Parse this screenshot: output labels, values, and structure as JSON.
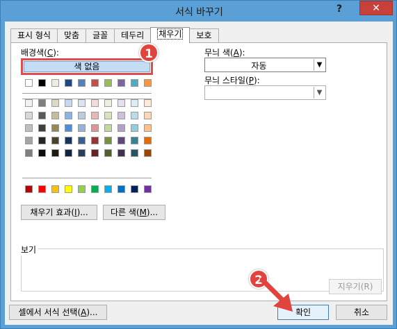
{
  "window": {
    "title": "서식 바꾸기",
    "help": "?",
    "close": "✕"
  },
  "tabs": [
    {
      "label": "표시 형식"
    },
    {
      "label": "맞춤"
    },
    {
      "label": "글꼴"
    },
    {
      "label": "테두리"
    },
    {
      "label": "채우기",
      "active": true
    },
    {
      "label": "보호"
    }
  ],
  "fill": {
    "bg_label_prefix": "배경색(",
    "bg_label_key": "C",
    "bg_label_suffix": "):",
    "no_color": "색 없음",
    "theme_row": [
      "#ffffff",
      "#000000",
      "#eeece1",
      "#1f497d",
      "#4f81bd",
      "#c0504d",
      "#9bbb59",
      "#8064a2",
      "#4bacc6",
      "#f79646"
    ],
    "shade_rows": [
      [
        "#f2f2f2",
        "#7f7f7f",
        "#ddd9c3",
        "#c6d9f0",
        "#dbe5f1",
        "#f2dcdb",
        "#ebf1dd",
        "#e5e0ec",
        "#dbeef3",
        "#fdeada"
      ],
      [
        "#d8d8d8",
        "#595959",
        "#c4bd97",
        "#8db3e2",
        "#b8cce4",
        "#e5b9b7",
        "#d7e3bc",
        "#ccc1d9",
        "#b7dde8",
        "#fbd5b5"
      ],
      [
        "#bfbfbf",
        "#3f3f3f",
        "#938953",
        "#548dd4",
        "#95b3d7",
        "#d99694",
        "#c3d69b",
        "#b2a2c7",
        "#92cddc",
        "#fac08f"
      ],
      [
        "#a5a5a5",
        "#262626",
        "#494429",
        "#17365d",
        "#366092",
        "#953734",
        "#76923c",
        "#5f497a",
        "#31859b",
        "#e36c09"
      ],
      [
        "#7f7f7f",
        "#0c0c0c",
        "#1d1b10",
        "#0f243e",
        "#244061",
        "#632423",
        "#4f6128",
        "#3f3151",
        "#205867",
        "#974806"
      ]
    ],
    "standard_row": [
      "#c00000",
      "#ff0000",
      "#ffc000",
      "#ffff00",
      "#92d050",
      "#00b050",
      "#00b0f0",
      "#0070c0",
      "#002060",
      "#7030a0"
    ],
    "fill_effects_prefix": "채우기 효과(",
    "fill_effects_key": "I",
    "fill_effects_suffix": ")...",
    "more_colors_prefix": "다른 색(",
    "more_colors_key": "M",
    "more_colors_suffix": ")...",
    "pattern_color_prefix": "무늬 색(",
    "pattern_color_key": "A",
    "pattern_color_suffix": "):",
    "pattern_color_value": "자동",
    "pattern_style_prefix": "무늬 스타일(",
    "pattern_style_key": "P",
    "pattern_style_suffix": "):",
    "pattern_style_value": "",
    "preview_label": "보기",
    "clear_button": "지우기(R)"
  },
  "footer": {
    "choose_format_prefix": "셀에서 서식 선택(",
    "choose_format_key": "A",
    "choose_format_suffix": ")...",
    "ok": "확인",
    "cancel": "취소"
  },
  "annotations": {
    "badge1": "1",
    "badge2": "2",
    "accent": "#e0443c"
  }
}
